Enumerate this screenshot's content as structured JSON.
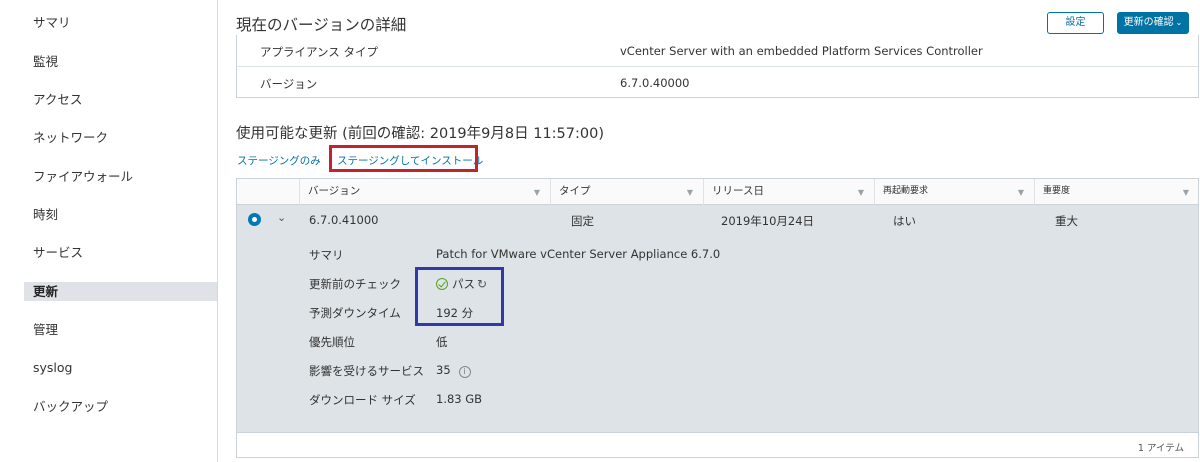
{
  "sidebar": {
    "items": [
      {
        "label": "サマリ"
      },
      {
        "label": "監視"
      },
      {
        "label": "アクセス"
      },
      {
        "label": "ネットワーク"
      },
      {
        "label": "ファイアウォール"
      },
      {
        "label": "時刻"
      },
      {
        "label": "サービス"
      },
      {
        "label": "更新"
      },
      {
        "label": "管理"
      },
      {
        "label": "syslog"
      },
      {
        "label": "バックアップ"
      }
    ],
    "active": "更新"
  },
  "header": {
    "title": "現在のバージョンの詳細",
    "settings_label": "設定",
    "check_updates_label": "更新の確認"
  },
  "current_version": {
    "rows": [
      {
        "label": "アプライアンス タイプ",
        "value": "vCenter Server with an embedded Platform Services Controller"
      },
      {
        "label": "バージョン",
        "value": "6.7.0.40000"
      }
    ]
  },
  "updates": {
    "title": "使用可能な更新 (前回の確認: 2019年9月8日 11:57:00)",
    "action_stage_only": "ステージングのみ",
    "action_stage_install": "ステージングしてインストール",
    "columns": [
      "バージョン",
      "タイプ",
      "リリース日",
      "再起動要求",
      "重要度"
    ],
    "row": {
      "version": "6.7.0.41000",
      "type": "固定",
      "release_date": "2019年10月24日",
      "reboot_required": "はい",
      "severity": "重大"
    },
    "details": {
      "summary_label": "サマリ",
      "summary_value": "Patch for VMware vCenter Server Appliance 6.7.0",
      "precheck_label": "更新前のチェック",
      "precheck_value": "パス",
      "downtime_label": "予測ダウンタイム",
      "downtime_value": "192 分",
      "priority_label": "優先順位",
      "priority_value": "低",
      "services_label": "影響を受けるサービス",
      "services_value": "35",
      "download_label": "ダウンロード サイズ",
      "download_value": "1.83 GB"
    },
    "item_count": "1 アイテム"
  },
  "colors": {
    "accent": "#0072a3",
    "highlight_red": "#c3232d",
    "highlight_blue": "#303aa6",
    "selected_row_bg": "#dde3e7",
    "ok_green": "#5aa220"
  }
}
